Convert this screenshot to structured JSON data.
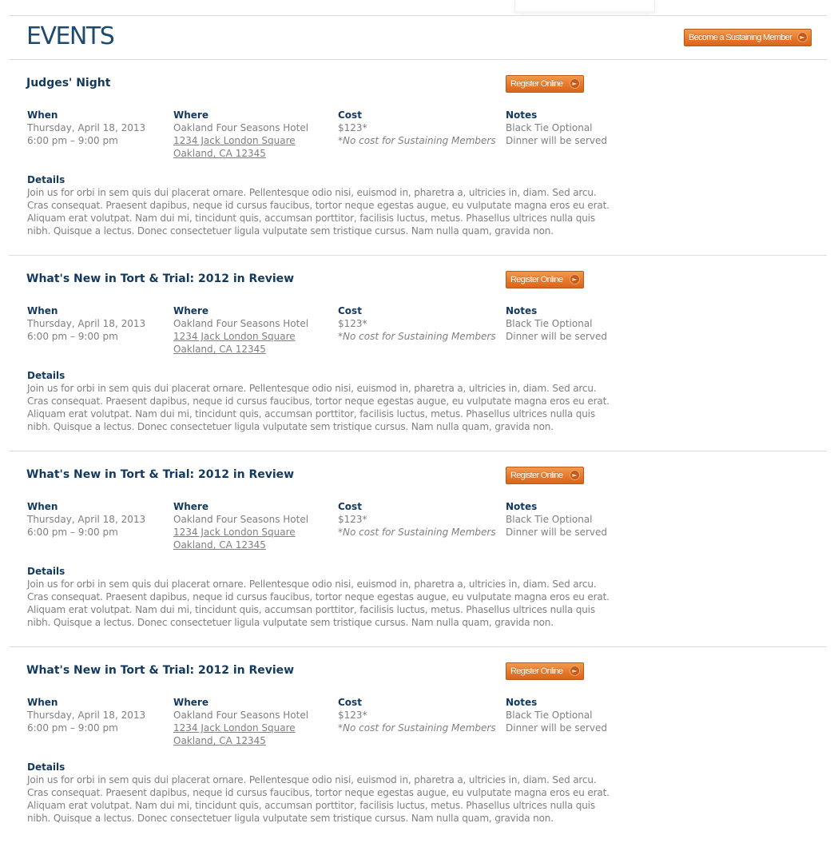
{
  "page": {
    "title": "EVENTS",
    "sustaining_button_label": "Become a Sustaining Member"
  },
  "labels": {
    "when": "When",
    "where": "Where",
    "cost": "Cost",
    "notes": "Notes",
    "details": "Details",
    "register": "Register Online"
  },
  "events": [
    {
      "title": "Judges' Night",
      "when_date": "Thursday, April 18, 2013",
      "when_time": "6:00 pm – 9:00 pm",
      "where_venue": "Oakland Four Seasons Hotel",
      "where_address": "1234 Jack London Square",
      "where_city": "Oakland, CA 12345",
      "cost_price": "$123*",
      "cost_note": "*No cost for Sustaining Members",
      "notes_1": "Black Tie Optional",
      "notes_2": "Dinner will be served",
      "details": "Join us for orbi in sem quis dui placerat ornare. Pellentesque odio nisi, euismod in, pharetra a, ultricies in, diam. Sed arcu. Cras consequat. Praesent dapibus, neque id cursus faucibus, tortor neque egestas augue, eu vulputate magna eros eu erat. Aliquam erat volutpat. Nam dui mi, tincidunt quis, accumsan porttitor, facilisis luctus, metus. Phasellus ultrices nulla quis nibh. Quisque a lectus. Donec consectetuer ligula vulputate sem tristique cursus. Nam nulla quam, gravida non."
    },
    {
      "title": "What's New in Tort & Trial: 2012 in Review",
      "when_date": "Thursday, April 18, 2013",
      "when_time": "6:00 pm – 9:00 pm",
      "where_venue": "Oakland Four Seasons Hotel",
      "where_address": "1234 Jack London Square",
      "where_city": "Oakland, CA 12345",
      "cost_price": "$123*",
      "cost_note": "*No cost for Sustaining Members",
      "notes_1": "Black Tie Optional",
      "notes_2": "Dinner will be served",
      "details": "Join us for orbi in sem quis dui placerat ornare. Pellentesque odio nisi, euismod in, pharetra a, ultricies in, diam. Sed arcu. Cras consequat. Praesent dapibus, neque id cursus faucibus, tortor neque egestas augue, eu vulputate magna eros eu erat. Aliquam erat volutpat. Nam dui mi, tincidunt quis, accumsan porttitor, facilisis luctus, metus. Phasellus ultrices nulla quis nibh. Quisque a lectus. Donec consectetuer ligula vulputate sem tristique cursus. Nam nulla quam, gravida non."
    },
    {
      "title": "What's New in Tort & Trial: 2012 in Review",
      "when_date": "Thursday, April 18, 2013",
      "when_time": "6:00 pm – 9:00 pm",
      "where_venue": "Oakland Four Seasons Hotel",
      "where_address": "1234 Jack London Square",
      "where_city": "Oakland, CA 12345",
      "cost_price": "$123*",
      "cost_note": "*No cost for Sustaining Members",
      "notes_1": "Black Tie Optional",
      "notes_2": "Dinner will be served",
      "details": "Join us for orbi in sem quis dui placerat ornare. Pellentesque odio nisi, euismod in, pharetra a, ultricies in, diam. Sed arcu. Cras consequat. Praesent dapibus, neque id cursus faucibus, tortor neque egestas augue, eu vulputate magna eros eu erat. Aliquam erat volutpat. Nam dui mi, tincidunt quis, accumsan porttitor, facilisis luctus, metus. Phasellus ultrices nulla quis nibh. Quisque a lectus. Donec consectetuer ligula vulputate sem tristique cursus. Nam nulla quam, gravida non."
    },
    {
      "title": "What's New in Tort & Trial: 2012 in Review",
      "when_date": "Thursday, April 18, 2013",
      "when_time": "6:00 pm – 9:00 pm",
      "where_venue": "Oakland Four Seasons Hotel",
      "where_address": "1234 Jack London Square",
      "where_city": "Oakland, CA 12345",
      "cost_price": "$123*",
      "cost_note": "*No cost for Sustaining Members",
      "notes_1": "Black Tie Optional",
      "notes_2": "Dinner will be served",
      "details": "Join us for orbi in sem quis dui placerat ornare. Pellentesque odio nisi, euismod in, pharetra a, ultricies in, diam. Sed arcu. Cras consequat. Praesent dapibus, neque id cursus faucibus, tortor neque egestas augue, eu vulputate magna eros eu erat. Aliquam erat volutpat. Nam dui mi, tincidunt quis, accumsan porttitor, facilisis luctus, metus. Phasellus ultrices nulla quis nibh. Quisque a lectus. Donec consectetuer ligula vulputate sem tristique cursus. Nam nulla quam, gravida non."
    }
  ],
  "colors": {
    "title_navy": "#1f4a6e",
    "heading_navy": "#13395e",
    "body_gray": "#7f7f7f",
    "button_orange": "#e8782b",
    "rule_gray": "#dcdcdc"
  },
  "icons": {
    "button_arrow": "arrow-right-circle-icon"
  }
}
